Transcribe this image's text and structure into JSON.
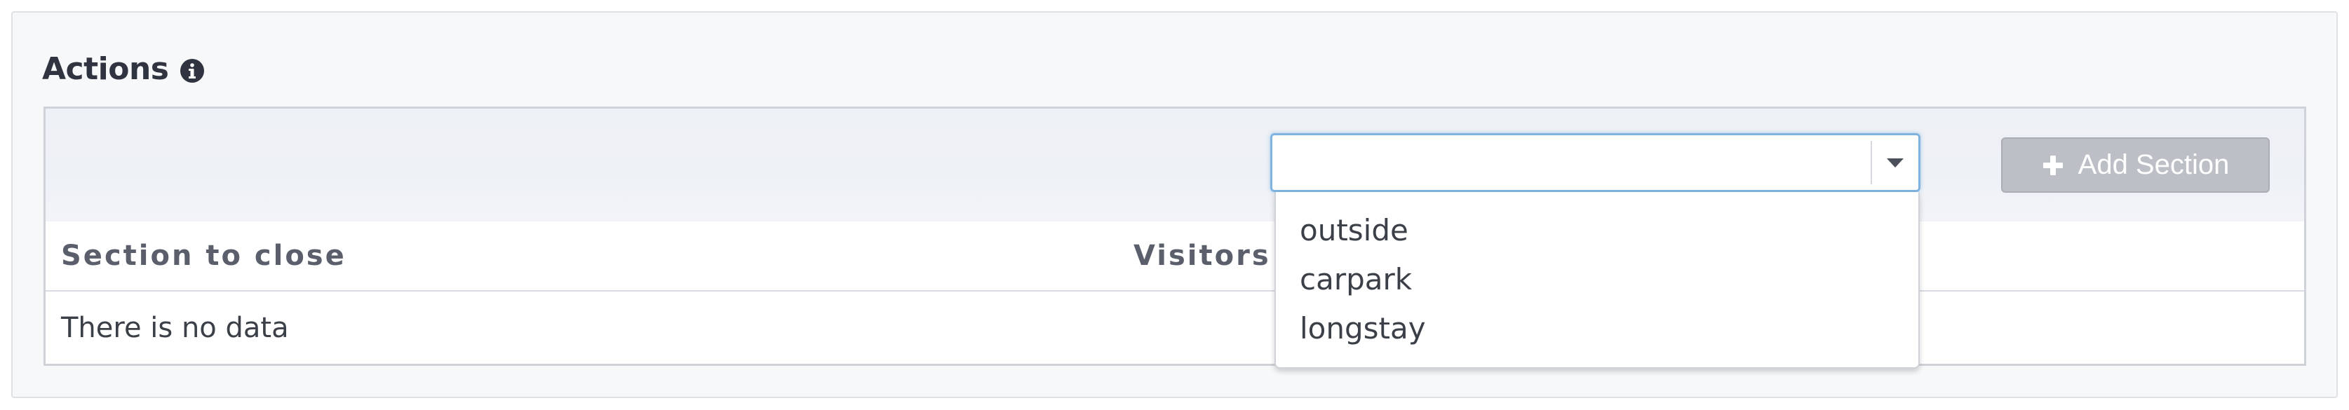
{
  "panel": {
    "title": "Actions",
    "info_icon": "info-circle-icon"
  },
  "toolbar": {
    "select": {
      "value": "",
      "caret_icon": "caret-down-icon",
      "options": [
        "outside",
        "carpark",
        "longstay"
      ]
    },
    "add_button": {
      "label": "Add Section",
      "icon": "plus-icon",
      "state": "disabled"
    }
  },
  "table": {
    "columns": [
      "Section to close",
      "Visitors"
    ],
    "empty_message": "There is no data"
  },
  "colors": {
    "focus_border": "#7fb4e0",
    "button_bg": "#bcbfc5",
    "heading_text": "#2f3440",
    "column_header_text": "#5a5f6b"
  }
}
